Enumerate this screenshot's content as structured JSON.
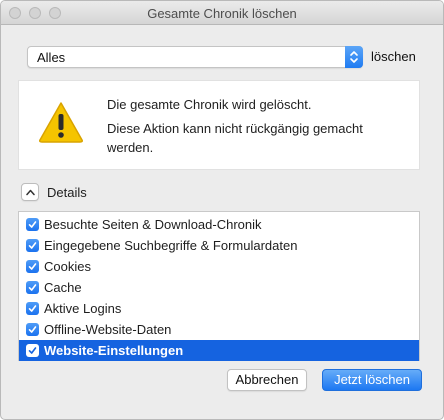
{
  "window": {
    "title": "Gesamte Chronik löschen"
  },
  "timerange": {
    "selected": "Alles",
    "action_label": "löschen"
  },
  "warning": {
    "line1": "Die gesamte Chronik wird gelöscht.",
    "line2": "Diese Aktion kann nicht rückgängig gemacht werden."
  },
  "details": {
    "label": "Details",
    "expanded": true
  },
  "items": [
    {
      "label": "Besuchte Seiten & Download-Chronik",
      "checked": true,
      "selected": false
    },
    {
      "label": "Eingegebene Suchbegriffe & Formulardaten",
      "checked": true,
      "selected": false
    },
    {
      "label": "Cookies",
      "checked": true,
      "selected": false
    },
    {
      "label": "Cache",
      "checked": true,
      "selected": false
    },
    {
      "label": "Aktive Logins",
      "checked": true,
      "selected": false
    },
    {
      "label": "Offline-Website-Daten",
      "checked": true,
      "selected": false
    },
    {
      "label": "Website-Einstellungen",
      "checked": true,
      "selected": true
    }
  ],
  "buttons": {
    "cancel": "Abbrechen",
    "confirm": "Jetzt löschen"
  },
  "colors": {
    "accent": "#1d78f2",
    "selection": "#1563e0",
    "warning": "#f5c400"
  }
}
